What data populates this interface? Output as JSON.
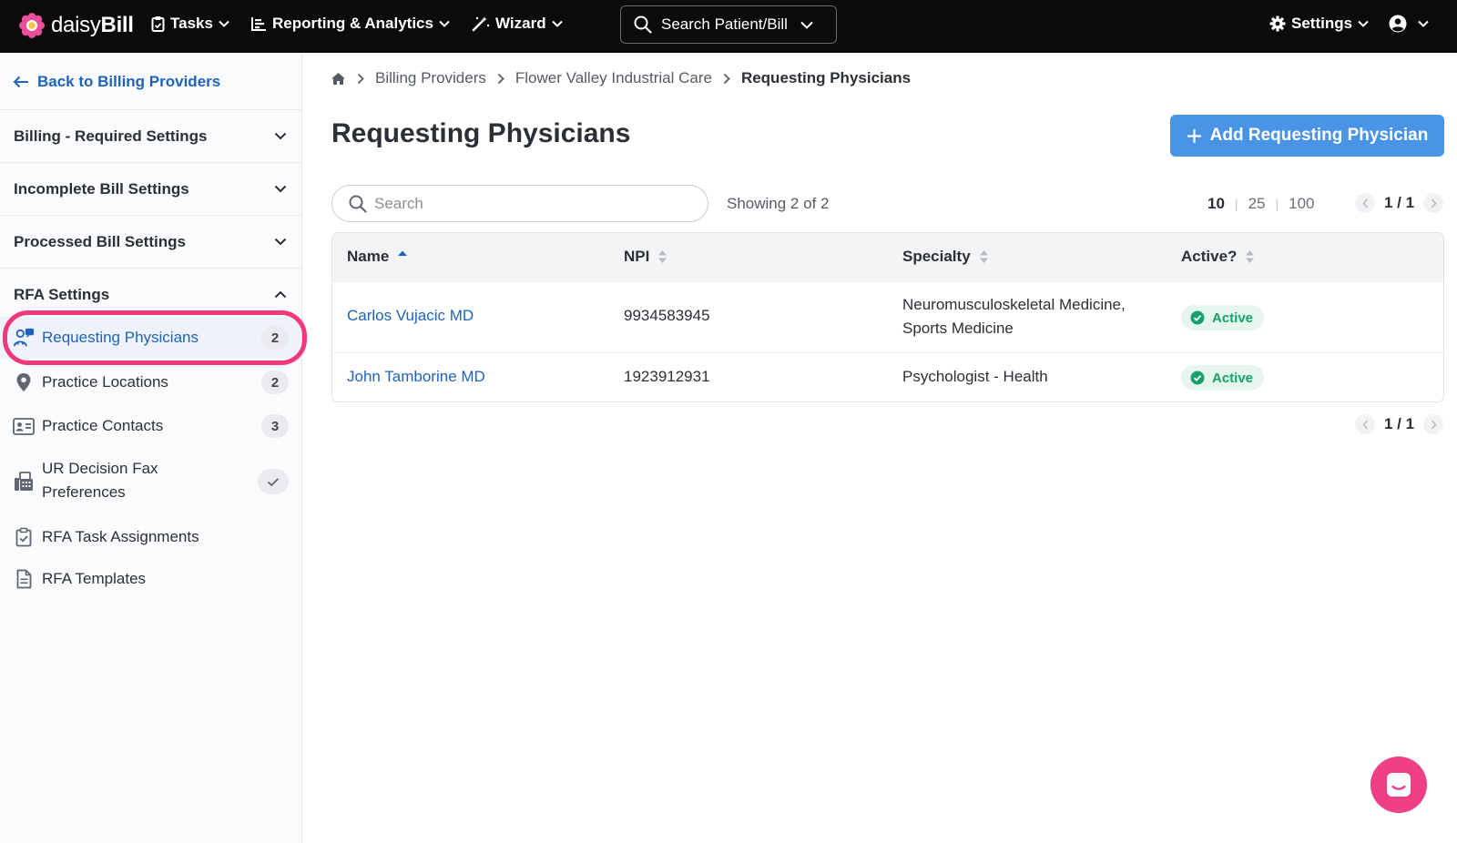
{
  "app": {
    "logo_text_light": "daisy",
    "logo_text_bold": "Bill"
  },
  "topnav": {
    "tasks": "Tasks",
    "reporting": "Reporting & Analytics",
    "wizard": "Wizard",
    "search": "Search Patient/Bill",
    "settings": "Settings"
  },
  "sidebar": {
    "back_label": "Back to Billing Providers",
    "sections": [
      {
        "label": "Billing - Required Settings",
        "expanded": false
      },
      {
        "label": "Incomplete Bill Settings",
        "expanded": false
      },
      {
        "label": "Processed Bill Settings",
        "expanded": false
      },
      {
        "label": "RFA Settings",
        "expanded": true
      }
    ],
    "items": [
      {
        "label": "Requesting Physicians",
        "count": "2",
        "icon": "physician-icon",
        "active": true
      },
      {
        "label": "Practice Locations",
        "count": "2",
        "icon": "map-pin-icon"
      },
      {
        "label": "Practice Contacts",
        "count": "3",
        "icon": "contact-card-icon"
      },
      {
        "label_line1": "UR Decision Fax",
        "label_line2": "Preferences",
        "icon": "fax-icon",
        "status": "check-icon"
      },
      {
        "label": "RFA Task Assignments",
        "icon": "clipboard-check-icon"
      },
      {
        "label": "RFA Templates",
        "icon": "document-icon"
      }
    ]
  },
  "breadcrumb": [
    "Billing Providers",
    "Flower Valley Industrial Care",
    "Requesting Physicians"
  ],
  "page": {
    "title": "Requesting Physicians",
    "add_button": "Add Requesting Physician"
  },
  "table_controls": {
    "search_placeholder": "Search",
    "showing": "Showing 2 of 2",
    "page_sizes": [
      "10",
      "25",
      "100"
    ],
    "selected_page_size": "10",
    "pagination": "1 / 1"
  },
  "table": {
    "columns": [
      "Name",
      "NPI",
      "Specialty",
      "Active?"
    ],
    "sorted_column": "Name",
    "sort_direction": "ascending",
    "rows": [
      {
        "name": "Carlos Vujacic MD",
        "npi": "9934583945",
        "specialty_line1": "Neuromusculoskeletal Medicine,",
        "specialty_line2": "Sports Medicine",
        "active": "Active"
      },
      {
        "name": "John Tamborine MD",
        "npi": "1923912931",
        "specialty_line1": "Psychologist - Health",
        "active": "Active"
      }
    ]
  },
  "colors": {
    "topbar": "#0b0b0c",
    "link": "#1f63b8",
    "primary_button": "#4a94e6",
    "active_badge_bg": "#e6f6ee",
    "active_badge_text": "#16a06a",
    "highlight_ring": "#f0387a",
    "chat_button": "#ef3f86"
  }
}
